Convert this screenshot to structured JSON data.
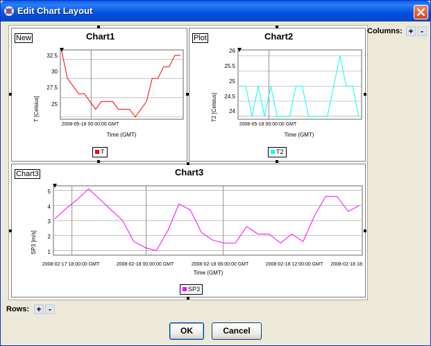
{
  "window": {
    "title": "Edit Chart Layout",
    "colors": {
      "titlebar": "#0a5fe6",
      "close": "#d9431d",
      "face": "#ece9d8"
    }
  },
  "controls": {
    "columns_label": "Columns:",
    "rows_label": "Rows:",
    "plus": "+",
    "minus": "-",
    "ok": "OK",
    "cancel": "Cancel"
  },
  "charts": [
    {
      "tag": "New",
      "title": "Chart1",
      "ylabel": "T [Celsius]",
      "xlabel": "Time (GMT)",
      "xticks": [
        "2008-05-18 00:00:00 GMT"
      ],
      "yticks": [
        "25",
        "27.5",
        "30",
        "32.5"
      ],
      "legend": "T",
      "color": "#ff0000"
    },
    {
      "tag": "Plot",
      "title": "Chart2",
      "ylabel": "T2 [Celsius]",
      "xlabel": "Time (GMT)",
      "xticks": [
        "2008-05-18 00:00:00 GMT"
      ],
      "yticks": [
        "24",
        "24.5",
        "25",
        "25.5",
        "26"
      ],
      "legend": "T2",
      "color": "#00ffff"
    },
    {
      "tag": "Chart3",
      "title": "Chart3",
      "ylabel": "SP3 [m/s]",
      "xlabel": "Time (GMT)",
      "xticks": [
        "2008-02-17 18:00:00 GMT",
        "2008-02-18 00:00:00 GMT",
        "2008-02-18 06:00:00 GMT",
        "2008-02-18 12:00:00 GMT",
        "2008-02-18 18:"
      ],
      "yticks": [
        "1",
        "2",
        "3",
        "4",
        "5"
      ],
      "legend": "SP3",
      "color": "#ff00ff"
    }
  ],
  "chart_data": [
    {
      "type": "line",
      "title": "Chart1",
      "xlabel": "Time (GMT)",
      "ylabel": "T [Celsius]",
      "ylim": [
        24.7,
        33.7
      ],
      "grid": true,
      "series": [
        {
          "name": "T",
          "values": [
            33.5,
            30,
            29,
            28,
            28,
            27,
            26,
            27,
            27,
            27,
            26,
            26,
            26,
            25,
            26,
            27,
            30,
            30,
            31.5,
            31.5,
            33,
            33
          ]
        }
      ]
    },
    {
      "type": "line",
      "title": "Chart2",
      "xlabel": "Time (GMT)",
      "ylabel": "T2 [Celsius]",
      "ylim": [
        23.9,
        26.2
      ],
      "grid": true,
      "series": [
        {
          "name": "T2",
          "values": [
            25,
            25,
            24,
            25,
            24,
            25,
            24,
            24,
            24,
            25,
            25,
            24,
            24,
            24,
            24,
            25,
            26,
            25,
            25,
            24
          ]
        }
      ]
    },
    {
      "type": "line",
      "title": "Chart3",
      "xlabel": "Time (GMT)",
      "ylabel": "SP3 [m/s]",
      "ylim": [
        0.7,
        5.3
      ],
      "grid": true,
      "series": [
        {
          "name": "SP3",
          "values": [
            3.1,
            3.8,
            4.4,
            5.1,
            4.4,
            3.7,
            3.0,
            1.6,
            1.2,
            1.0,
            2.3,
            4.1,
            3.7,
            2.2,
            1.7,
            1.5,
            1.5,
            2.6,
            2.1,
            2.1,
            1.5,
            2.1,
            1.6,
            3.3,
            4.6,
            4.6,
            3.6,
            4.0
          ]
        }
      ]
    }
  ]
}
